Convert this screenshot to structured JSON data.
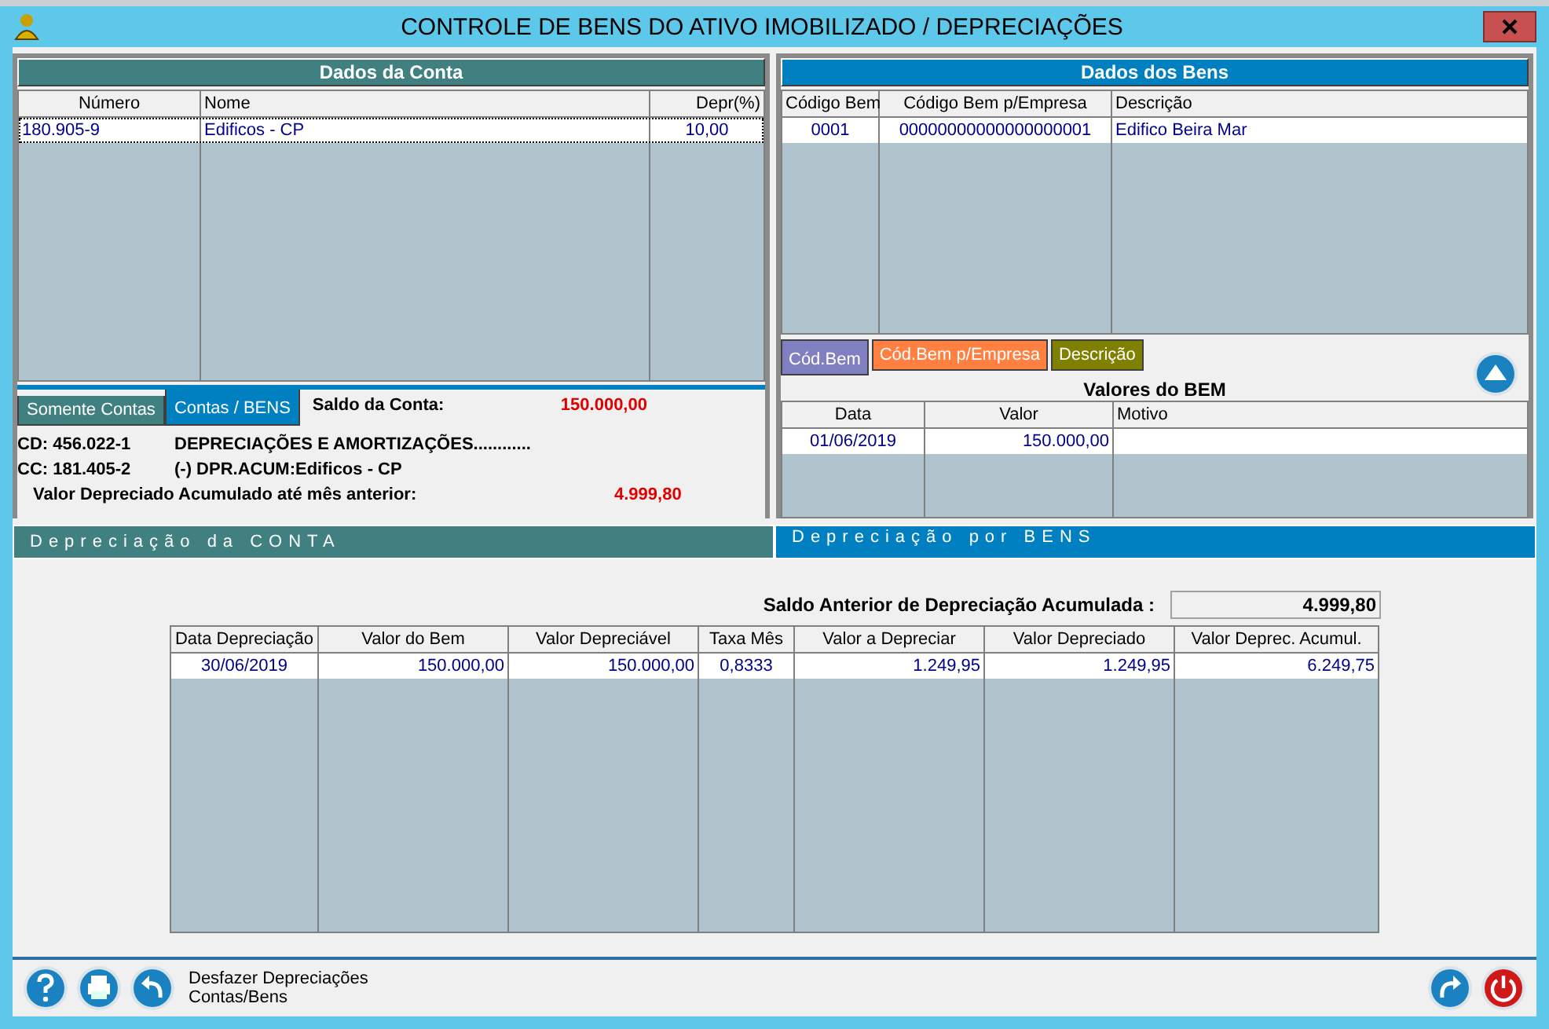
{
  "window": {
    "title": "CONTROLE DE BENS DO ATIVO IMOBILIZADO / DEPRECIAÇÕES"
  },
  "account_panel": {
    "header": "Dados da Conta",
    "table": {
      "columns": [
        "Número",
        "Nome",
        "Depr(%)"
      ],
      "rows": [
        {
          "cells": [
            "180.905-9",
            "Edificos - CP",
            "10,00"
          ],
          "selected": true
        }
      ]
    },
    "tabs": [
      {
        "label": "Somente Contas",
        "selected": false
      },
      {
        "label": "Contas / BENS",
        "selected": true
      }
    ],
    "balance_label": "Saldo da Conta:",
    "balance": "150.000,00",
    "cd_code": "CD: 456.022-1",
    "cd_name": "DEPRECIAÇÕES E AMORTIZAÇÕES............",
    "cc_code": "CC: 181.405-2",
    "cc_name": "(-) DPR.ACUM:Edificos - CP",
    "accumulated_label": "Valor Depreciado Acumulado até mês anterior:",
    "accumulated": "4.999,80"
  },
  "assets_panel": {
    "header": "Dados dos Bens",
    "table": {
      "columns": [
        "Código Bem",
        "Código Bem p/Empresa",
        "Descrição"
      ],
      "rows": [
        {
          "cells": [
            "0001",
            "00000000000000000001",
            "Edifico Beira Mar"
          ]
        }
      ]
    },
    "sort_tabs": [
      {
        "label": "Cód.Bem",
        "color": "#8080c0",
        "selected": true
      },
      {
        "label": "Cód.Bem p/Empresa",
        "color": "#ff8040",
        "selected": false
      },
      {
        "label": "Descrição",
        "color": "#808000",
        "selected": false
      }
    ],
    "values_title": "Valores do BEM",
    "values_table": {
      "columns": [
        "Data",
        "Valor",
        "Motivo"
      ],
      "rows": [
        {
          "cells": [
            "01/06/2019",
            "150.000,00",
            ""
          ]
        }
      ]
    }
  },
  "section_tabs": [
    {
      "label": "Depreciação da CONTA",
      "selected": false
    },
    {
      "label": "Depreciação por BENS",
      "selected": true
    }
  ],
  "depreciation": {
    "previous_label": "Saldo Anterior de Depreciação Acumulada :",
    "previous_value": "4.999,80",
    "table": {
      "columns": [
        "Data Depreciação",
        "Valor do Bem",
        "Valor Depreciável",
        "Taxa Mês",
        "Valor a Depreciar",
        "Valor Depreciado",
        "Valor Deprec. Acumul."
      ],
      "rows": [
        {
          "cells": [
            "30/06/2019",
            "150.000,00",
            "150.000,00",
            "0,8333",
            "1.249,95",
            "1.249,95",
            "6.249,75"
          ]
        }
      ]
    }
  },
  "footer": {
    "undo_lines": [
      "Desfazer Depreciações",
      "Contas/Bens"
    ]
  }
}
